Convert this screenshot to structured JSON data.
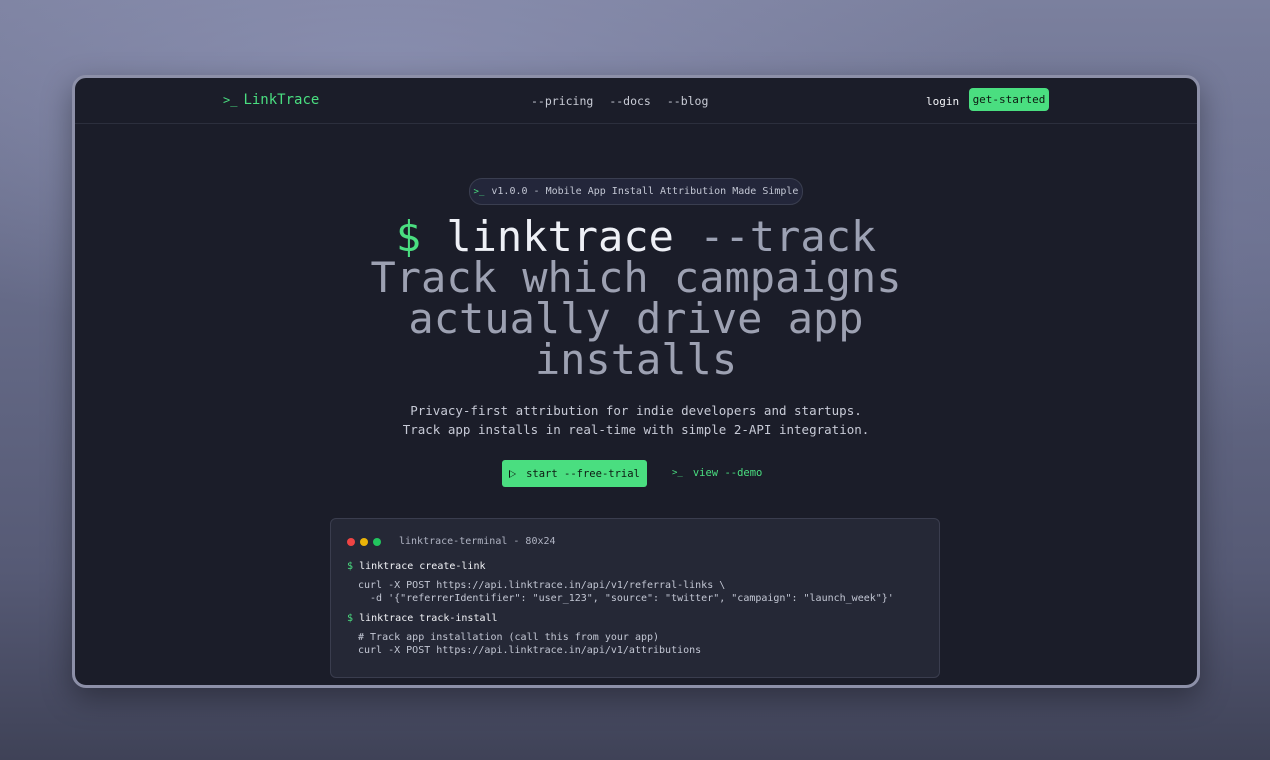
{
  "nav": {
    "logo_prompt": ">_",
    "logo_text": "LinkTrace",
    "links": [
      "--pricing",
      "--docs",
      "--blog"
    ],
    "login": "login",
    "get_started": "get-started"
  },
  "badge": {
    "prompt": ">_",
    "text": "v1.0.0 - Mobile App Install Attribution Made Simple"
  },
  "hero": {
    "dollar": "$",
    "command": "linktrace",
    "flag": "--track",
    "line2": "Track which campaigns",
    "line3": "actually drive app",
    "line4": "installs"
  },
  "subtitle": {
    "line1": "Privacy-first attribution for indie developers and startups.",
    "line2": "Track app installs in real-time with simple 2-API integration."
  },
  "cta": {
    "primary": "start --free-trial",
    "secondary_prompt": ">_",
    "secondary": "view --demo"
  },
  "terminal": {
    "title": "linktrace-terminal - 80x24",
    "dot_colors": [
      "#ef4444",
      "#eab308",
      "#22c55e"
    ],
    "prompt": "$",
    "cmd1": "linktrace create-link",
    "code1a": "curl -X POST https://api.linktrace.in/api/v1/referral-links \\",
    "code1b": "  -d '{\"referrerIdentifier\": \"user_123\", \"source\": \"twitter\", \"campaign\": \"launch_week\"}'",
    "cmd2": "linktrace track-install",
    "code2a": "# Track app installation (call this from your app)",
    "code2b": "curl -X POST https://api.linktrace.in/api/v1/attributions"
  },
  "colors": {
    "accent": "#4ade80",
    "background": "#1b1d29"
  }
}
